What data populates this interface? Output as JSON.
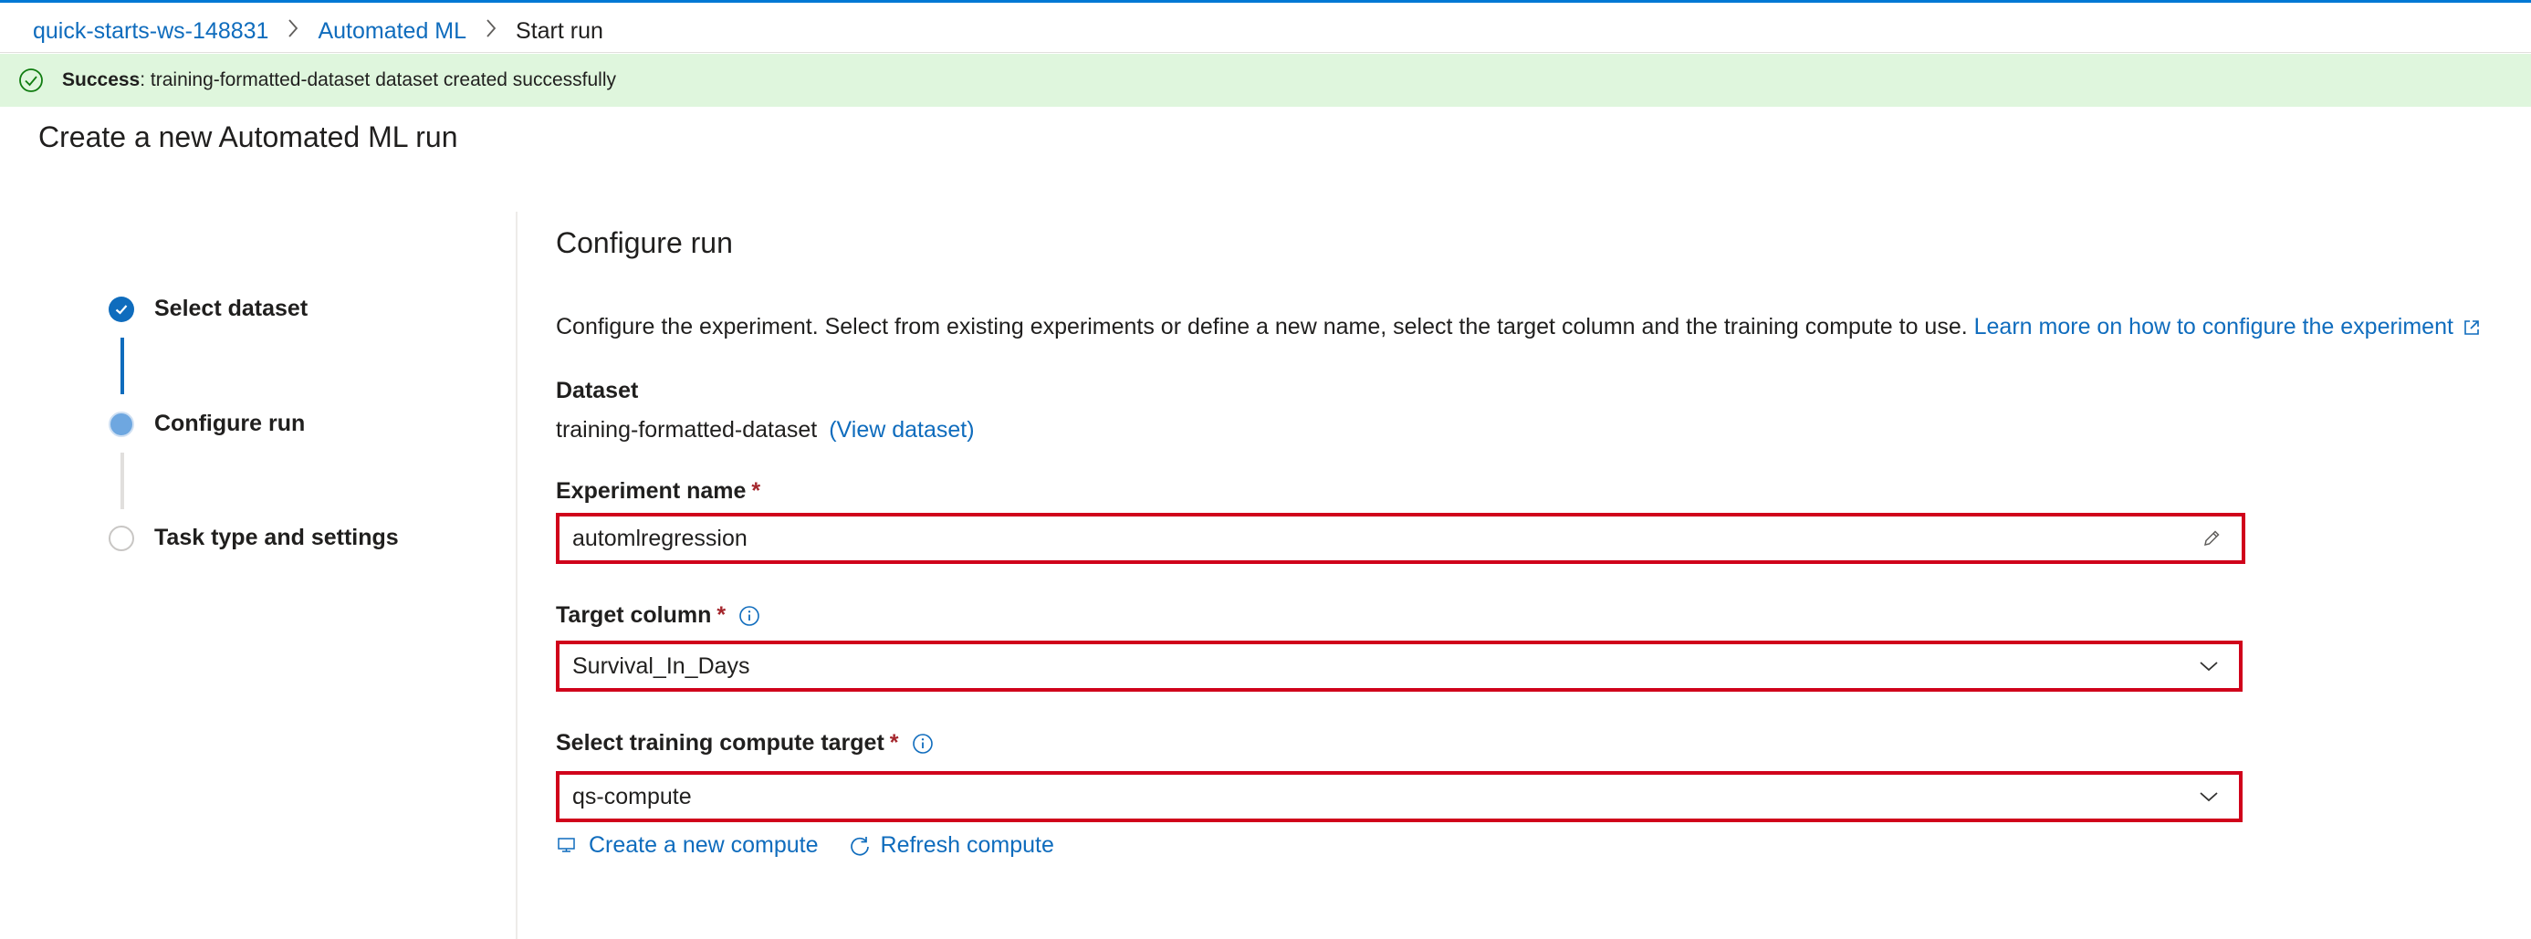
{
  "breadcrumb": {
    "workspace": "quick-starts-ws-148831",
    "section": "Automated ML",
    "current": "Start run"
  },
  "banner": {
    "status": "Success",
    "message": " : training-formatted-dataset dataset created successfully",
    "color": "#dff6dd"
  },
  "page_title": "Create a new Automated ML run",
  "steps": [
    {
      "label": "Select dataset",
      "state": "done"
    },
    {
      "label": "Configure run",
      "state": "current"
    },
    {
      "label": "Task type and settings",
      "state": "todo"
    }
  ],
  "configure": {
    "title": "Configure run",
    "description": "Configure the experiment. Select from existing experiments or define a new name, select the target column and the training compute to use. ",
    "learn_more": "Learn more on how to configure the experiment",
    "dataset_label": "Dataset",
    "dataset_name": "training-formatted-dataset",
    "view_dataset": "(View dataset)",
    "experiment_label": "Experiment name",
    "experiment_value": "automlregression",
    "target_label": "Target column",
    "target_value": "Survival_In_Days",
    "compute_label": "Select training compute target",
    "compute_value": "qs-compute",
    "required_mark": "*",
    "create_compute": "Create a new compute",
    "refresh_compute": "Refresh compute"
  },
  "colors": {
    "accent": "#0f6cbd",
    "highlight_border": "#d0021b",
    "required": "#a4262c"
  },
  "icons": [
    "chevron-right-icon",
    "check-circle-icon",
    "pencil-icon",
    "chevron-down-icon",
    "info-icon",
    "external-link-icon",
    "compute-icon",
    "refresh-icon"
  ]
}
